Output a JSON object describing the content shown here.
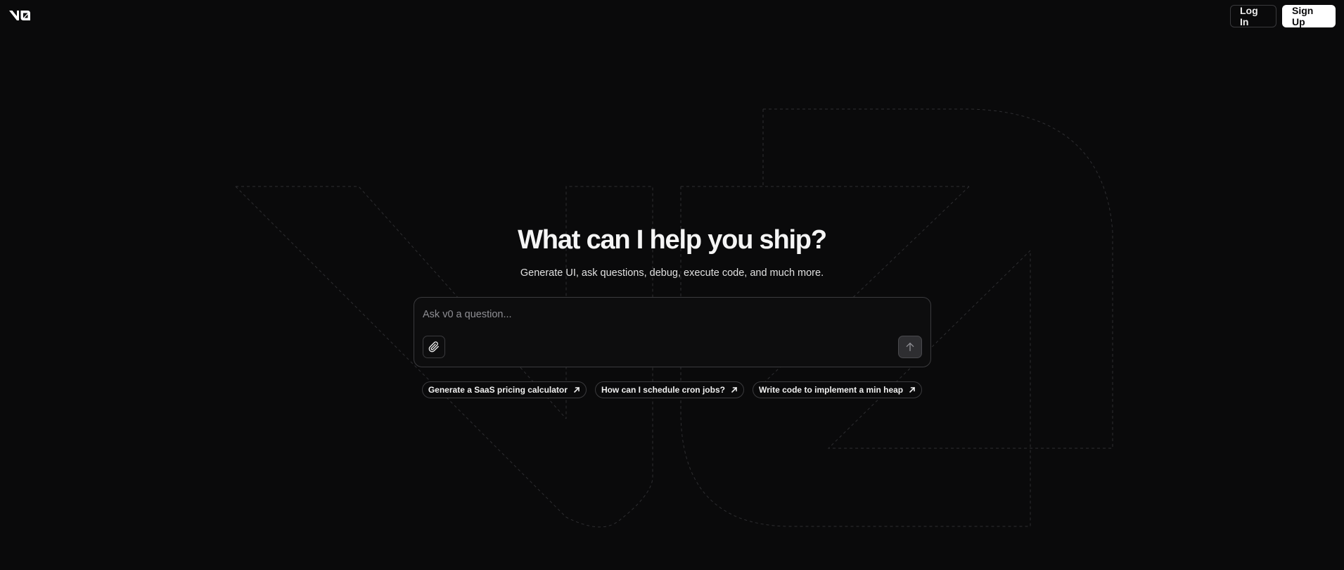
{
  "app": {
    "logo": "v0",
    "logo_icon": "v0-logo-icon"
  },
  "nav": {
    "login_label": "Log In",
    "signup_label": "Sign Up"
  },
  "hero": {
    "title": "What can I help you ship?",
    "subtitle": "Generate UI, ask questions, debug, execute code, and much more."
  },
  "chat": {
    "placeholder": "Ask v0 a question...",
    "value": "",
    "attach_icon": "paperclip-icon",
    "send_icon": "arrow-up-icon"
  },
  "suggestions": [
    {
      "label": "Generate a SaaS pricing calculator",
      "icon": "arrow-up-right-icon"
    },
    {
      "label": "How can I schedule cron jobs?",
      "icon": "arrow-up-right-icon"
    },
    {
      "label": "Write code to implement a min heap",
      "icon": "arrow-up-right-icon"
    }
  ],
  "colors": {
    "background": "#0a0a0b",
    "text": "#ededed",
    "border": "#3b3b3e",
    "primary_button": "#ffffff"
  }
}
